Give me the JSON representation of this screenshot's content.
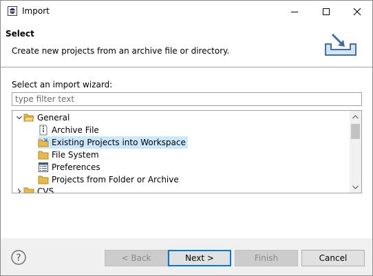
{
  "window": {
    "title": "Import"
  },
  "header": {
    "title": "Select",
    "description": "Create new projects from an archive file or directory."
  },
  "content": {
    "wizard_label": "Select an import wizard:",
    "filter_placeholder": "type filter text",
    "filter_value": ""
  },
  "tree": {
    "general": {
      "label": "General",
      "expanded": true
    },
    "items": [
      {
        "label": "Archive File",
        "icon": "archive-file-icon"
      },
      {
        "label": "Existing Projects into Workspace",
        "icon": "existing-projects-icon",
        "selected": true
      },
      {
        "label": "File System",
        "icon": "folder-icon"
      },
      {
        "label": "Preferences",
        "icon": "preferences-icon"
      },
      {
        "label": "Projects from Folder or Archive",
        "icon": "folder-icon"
      }
    ],
    "cvs": {
      "label": "CVS",
      "expanded": false
    }
  },
  "buttons": {
    "back": "< Back",
    "next": "Next >",
    "finish": "Finish",
    "cancel": "Cancel"
  },
  "colors": {
    "selection": "#cce8ff",
    "folder": "#e8b949",
    "accent": "#0078d7"
  }
}
